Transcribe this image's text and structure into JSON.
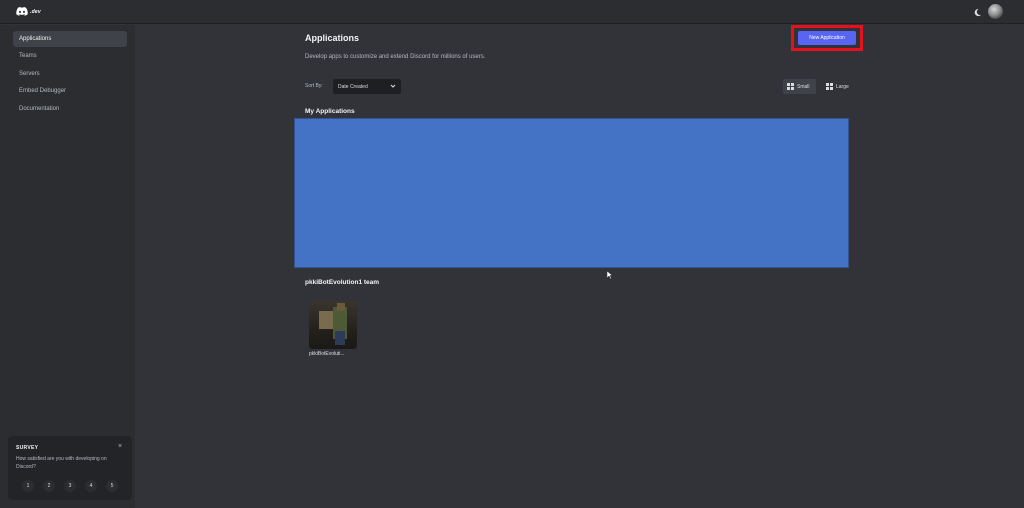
{
  "header": {
    "logo_text": ".dev",
    "theme_icon": "moon-icon",
    "avatar_icon": "avatar"
  },
  "sidebar": {
    "items": [
      {
        "label": "Applications",
        "active": true
      },
      {
        "label": "Teams",
        "active": false
      },
      {
        "label": "Servers",
        "active": false
      },
      {
        "label": "Embed Debugger",
        "active": false
      },
      {
        "label": "Documentation",
        "active": false
      }
    ]
  },
  "survey": {
    "title": "SURVEY",
    "close": "×",
    "question": "How satisfied are you with developing on Discord?",
    "ratings": [
      "1",
      "2",
      "3",
      "4",
      "5"
    ]
  },
  "main": {
    "title": "Applications",
    "subtitle": "Develop apps to customize and extend Discord for millions of users.",
    "new_app_label": "New Application",
    "sort_label": "Sort By:",
    "sort_value": "Date Created",
    "size_small": "Small",
    "size_large": "Large",
    "my_apps_title": "My Applications",
    "team_title": "pkkiBotEvolution1 team",
    "team_apps": [
      {
        "name": "pkkiBotEvoluti..."
      }
    ]
  },
  "colors": {
    "accent": "#5865f2",
    "highlight": "#e8101a",
    "placeholder": "#4472c4"
  }
}
